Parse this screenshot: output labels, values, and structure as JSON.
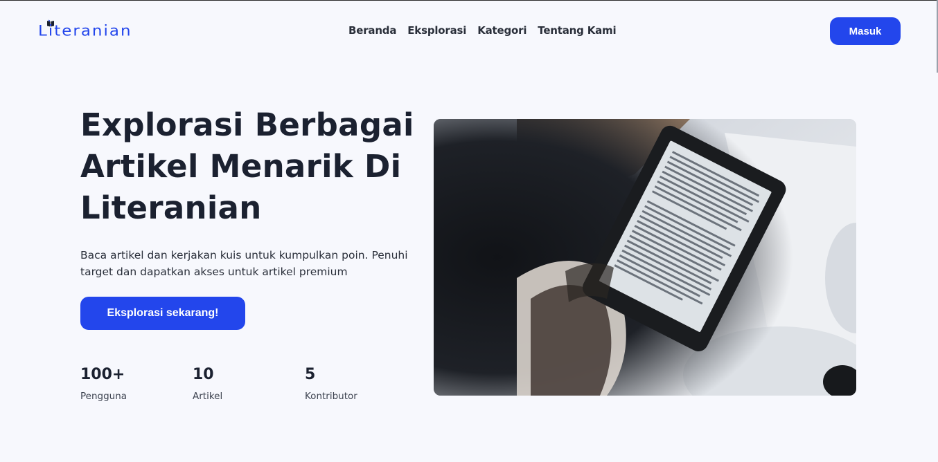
{
  "brand": {
    "name": "Literanian",
    "icon": "book-icon",
    "color": "#2346ec"
  },
  "nav": {
    "items": [
      {
        "label": "Beranda"
      },
      {
        "label": "Eksplorasi"
      },
      {
        "label": "Kategori"
      },
      {
        "label": "Tentang Kami"
      }
    ],
    "login_label": "Masuk"
  },
  "hero": {
    "title": "Explorasi Berbagai Artikel Menarik Di Literanian",
    "description": "Baca artikel dan kerjakan kuis untuk kumpulkan poin. Penuhi target dan dapatkan akses untuk artikel premium",
    "cta_label": "Eksplorasi sekarang!",
    "image_subject": "person reading an e-reader"
  },
  "stats": [
    {
      "value": "100+",
      "label": "Pengguna"
    },
    {
      "value": "10",
      "label": "Artikel"
    },
    {
      "value": "5",
      "label": "Kontributor"
    }
  ],
  "colors": {
    "accent": "#2346ec",
    "background": "#f7f8fd",
    "text": "#1b2130"
  }
}
